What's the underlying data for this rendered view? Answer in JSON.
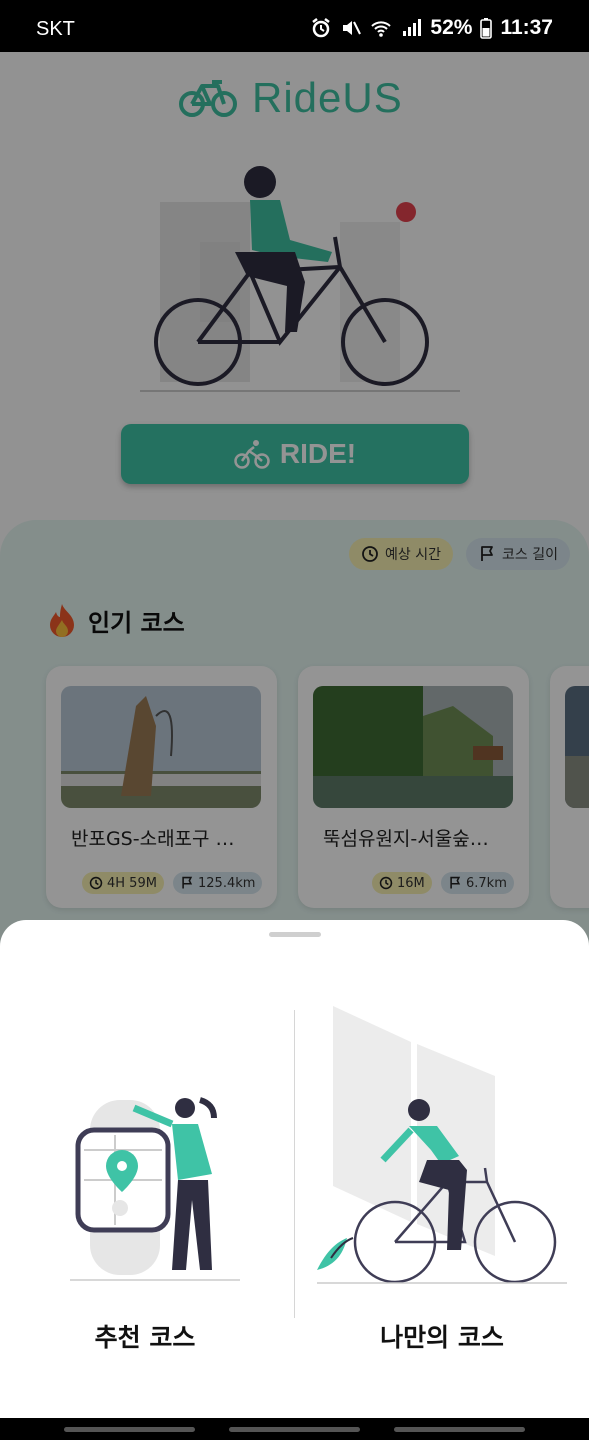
{
  "status_bar": {
    "carrier": "SKT",
    "battery": "52%",
    "time": "11:37",
    "icons": [
      "alarm-icon",
      "mute-icon",
      "wifi-icon",
      "signal-icon",
      "battery-icon"
    ]
  },
  "app": {
    "logo_text": "RideUS",
    "ride_button": "RIDE!",
    "filters": {
      "time_label": "예상 시간",
      "length_label": "코스 길이"
    },
    "section_title": "인기 코스",
    "courses": [
      {
        "name": "반포GS-소래포구 …",
        "time": "4H 59M",
        "length": "125.4km"
      },
      {
        "name": "뚝섬유원지-서울숲…",
        "time": "16M",
        "length": "6.7km"
      }
    ]
  },
  "sheet": {
    "options": [
      {
        "label": "추천 코스",
        "icon": "smartwatch-map-illustration"
      },
      {
        "label": "나만의 코스",
        "icon": "bicycle-rider-illustration"
      }
    ]
  },
  "colors": {
    "accent": "#3fc3a6",
    "time_chip": "#f6f0b2",
    "length_chip": "#d6e6ee",
    "panel": "#e3f4f0"
  }
}
